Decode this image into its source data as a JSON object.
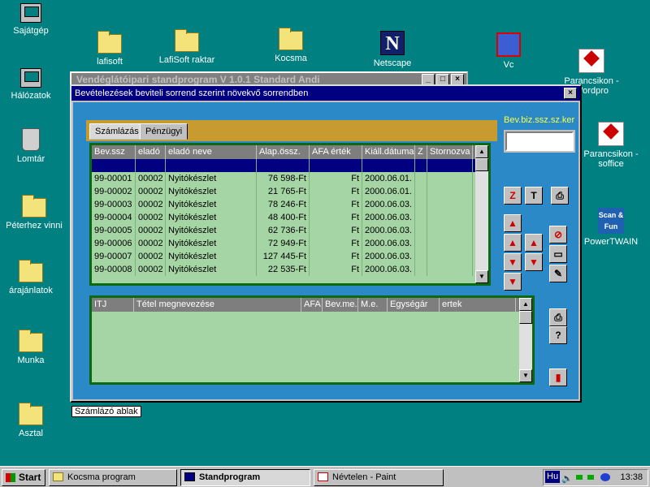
{
  "desktop": {
    "icons": [
      {
        "label": "Sajátgép"
      },
      {
        "label": "Hálózatok"
      },
      {
        "label": "Lomtár"
      },
      {
        "label": "Péterhez vinni"
      },
      {
        "label": "árajánlatok"
      },
      {
        "label": "Munka"
      },
      {
        "label": "Asztal"
      },
      {
        "label": "lafisoft"
      },
      {
        "label": "LafiSoft raktar"
      },
      {
        "label": "Kocsma"
      },
      {
        "label": "Netscape"
      },
      {
        "label": "Vc"
      },
      {
        "label": "Parancsikon - Wordpro"
      },
      {
        "label": "Parancsikon - soffice"
      },
      {
        "label": "PowerTWAIN"
      }
    ],
    "netscape_glyph": "N",
    "scan_glyph": "Scan & Fun"
  },
  "back_window": {
    "title": "Vendéglátóipari standprogram V 1.0.1 Standard Andi",
    "min": "_",
    "max": "□",
    "close": "×"
  },
  "main_window": {
    "title": "Bevételezések beviteli sorrend szerint növekvő sorrendben",
    "close": "×",
    "tabs": [
      "Számlázás",
      "Pénzügyi"
    ],
    "search_label": "Bev.biz.ssz.sz.ker",
    "search_value": "",
    "top_grid": {
      "columns": [
        "Bev.ssz",
        "eladó",
        "eladó neve",
        "Alap.össz.",
        "AFA érték",
        "Kiáll.dátuma",
        "Z",
        "Stornozva"
      ],
      "rows": [
        [
          "",
          "",
          "",
          "",
          "",
          "",
          "",
          ""
        ],
        [
          "99-00001",
          "00002",
          "Nyitókészlet",
          "76 598-Ft",
          "Ft",
          "2000.06.01.",
          "",
          ""
        ],
        [
          "99-00002",
          "00002",
          "Nyitókészlet",
          "21 765-Ft",
          "Ft",
          "2000.06.01.",
          "",
          ""
        ],
        [
          "99-00003",
          "00002",
          "Nyitókészlet",
          "78 246-Ft",
          "Ft",
          "2000.06.03.",
          "",
          ""
        ],
        [
          "99-00004",
          "00002",
          "Nyitókészlet",
          "48 400-Ft",
          "Ft",
          "2000.06.03.",
          "",
          ""
        ],
        [
          "99-00005",
          "00002",
          "Nyitókészlet",
          "62 736-Ft",
          "Ft",
          "2000.06.03.",
          "",
          ""
        ],
        [
          "99-00006",
          "00002",
          "Nyitókészlet",
          "72 949-Ft",
          "Ft",
          "2000.06.03.",
          "",
          ""
        ],
        [
          "99-00007",
          "00002",
          "Nyitókészlet",
          "127 445-Ft",
          "Ft",
          "2000.06.03.",
          "",
          ""
        ],
        [
          "99-00008",
          "00002",
          "Nyitókészlet",
          "22 535-Ft",
          "Ft",
          "2000.06.03.",
          "",
          ""
        ]
      ]
    },
    "bottom_grid": {
      "columns": [
        "ITJ",
        "Tétel megnevezése",
        "AFA",
        "Bev.me.",
        "M.e.",
        "Egységár",
        "ertek"
      ]
    },
    "tools": {
      "z": "Z",
      "t": "T",
      "print": "⎙",
      "help": "?",
      "up": "▲",
      "down": "▼",
      "cancel": "⊘",
      "new": "▭",
      "edit": "✎",
      "exit": "▮"
    }
  },
  "tooltip": "Számlázó ablak",
  "taskbar": {
    "start": "Start",
    "buttons": [
      "Kocsma program",
      "Standprogram",
      "Névtelen - Paint"
    ],
    "tray_lang": "Hu",
    "clock": "13:38"
  }
}
